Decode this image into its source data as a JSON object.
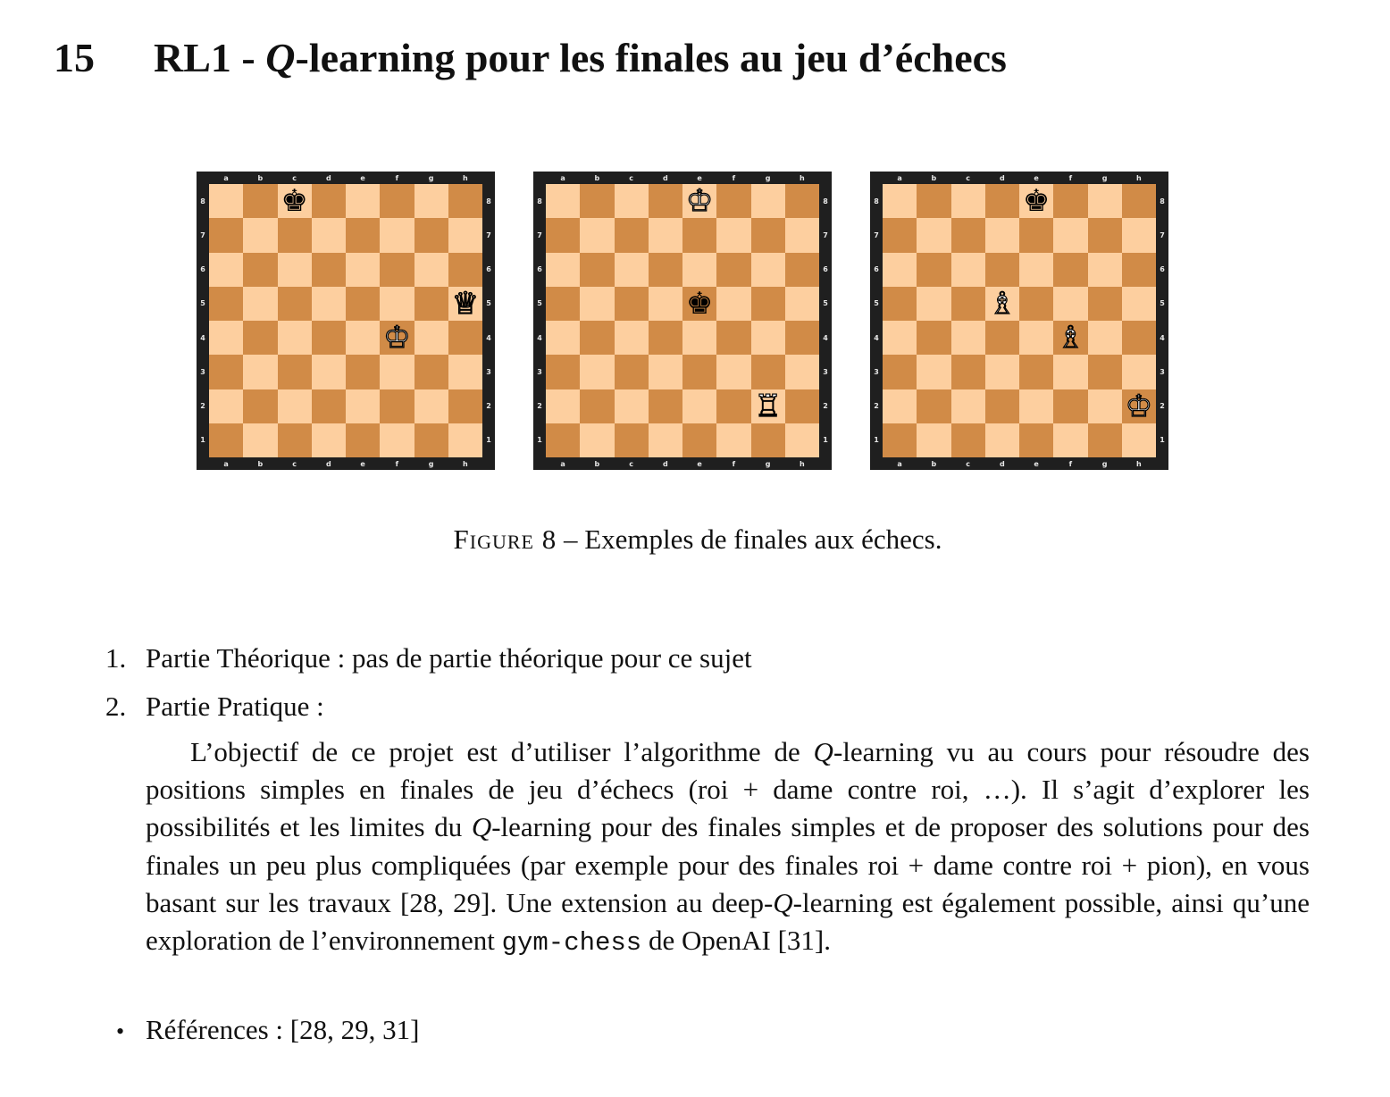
{
  "section": {
    "number": "15",
    "title_prefix": "RL1 - ",
    "title_italic": "Q",
    "title_rest": "-learning pour les finales au jeu d’échecs"
  },
  "figure": {
    "files": [
      "a",
      "b",
      "c",
      "d",
      "e",
      "f",
      "g",
      "h"
    ],
    "ranks": [
      "8",
      "7",
      "6",
      "5",
      "4",
      "3",
      "2",
      "1"
    ],
    "boards": [
      {
        "pieces": [
          {
            "square": "c8",
            "glyph": "♚",
            "color": "black"
          },
          {
            "square": "h5",
            "glyph": "♕",
            "color": "white"
          },
          {
            "square": "f4",
            "glyph": "♔",
            "color": "white"
          }
        ]
      },
      {
        "pieces": [
          {
            "square": "e8",
            "glyph": "♔",
            "color": "white"
          },
          {
            "square": "e5",
            "glyph": "♚",
            "color": "black"
          },
          {
            "square": "g2",
            "glyph": "♖",
            "color": "white"
          }
        ]
      },
      {
        "pieces": [
          {
            "square": "e8",
            "glyph": "♚",
            "color": "black"
          },
          {
            "square": "d5",
            "glyph": "♗",
            "color": "white"
          },
          {
            "square": "f4",
            "glyph": "♗",
            "color": "white"
          },
          {
            "square": "h2",
            "glyph": "♔",
            "color": "white"
          }
        ]
      }
    ],
    "colors": {
      "light": "#fdcf9f",
      "dark": "#d18b47",
      "frame": "#1f1f1f"
    },
    "caption_label": "Figure 8",
    "caption_sep": " – ",
    "caption_text": "Exemples de finales aux échecs."
  },
  "items": {
    "item1": {
      "label": "1.",
      "text": "Partie Théorique : pas de partie théorique pour ce sujet"
    },
    "item2": {
      "label": "2.",
      "text": "Partie Pratique :"
    }
  },
  "paragraph": {
    "s1": "L’objectif de ce projet est d’utiliser l’algorithme de ",
    "q1": "Q",
    "s2": "-learning vu au cours pour résoudre des positions simples en finales de jeu d’échecs (roi + dame contre roi, …). Il s’agit d’explorer les possibilités et les limites du ",
    "q2": "Q",
    "s3": "-learning pour des finales simples et de proposer des solutions pour des finales un peu plus compliquées (par exemple pour des finales roi + dame contre roi + pion), en vous basant sur les travaux [28, 29]. Une extension au deep-",
    "q3": "Q",
    "s4": "-learning est également possible, ainsi qu’une exploration de l’environnement ",
    "code": "gym-chess",
    "s5": " de OpenAI [31]."
  },
  "references": {
    "bullet": "•",
    "text": "Références : [28, 29, 31]"
  }
}
